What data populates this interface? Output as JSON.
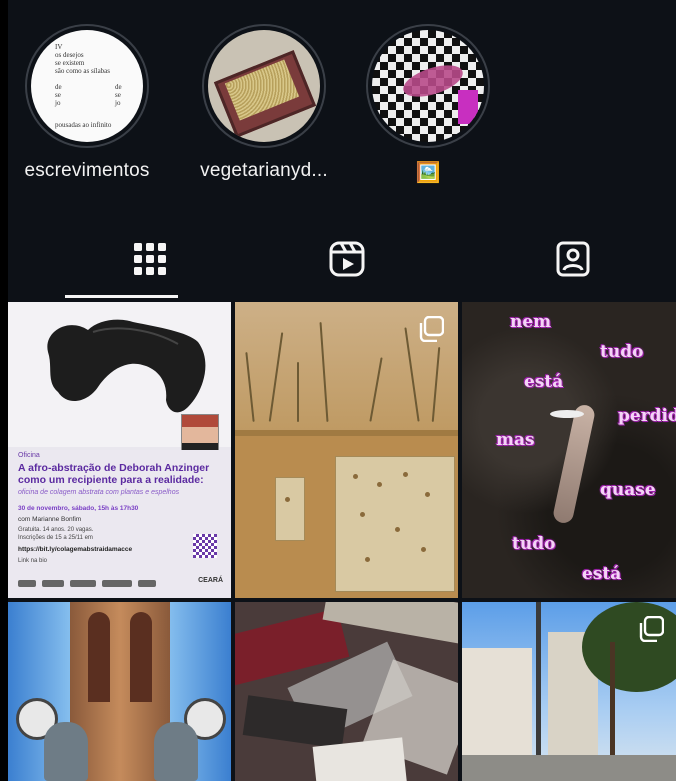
{
  "highlights": [
    {
      "name": "escrevimentos",
      "cover_lines": [
        "IV",
        "os desejos",
        "se existem",
        "são como as sílabas",
        "de",
        "se",
        "jo",
        "de",
        "se",
        "jo",
        "pousadas ao infinito"
      ]
    },
    {
      "name": "vegetarianyd..."
    },
    {
      "name": "🖼️"
    }
  ],
  "tabs": [
    {
      "id": "grid",
      "icon": "grid-icon",
      "selected": true
    },
    {
      "id": "reels",
      "icon": "reels-icon",
      "selected": false
    },
    {
      "id": "tagged",
      "icon": "tagged-icon",
      "selected": false
    }
  ],
  "posts": {
    "p1": {
      "kicker": "Oficina",
      "title": "A afro-abstração de Deborah Anzinger como um recipiente para a realidade:",
      "subtitle": "oficina de colagem abstrata com plantas e espelhos",
      "date": "30 de novembro, sábado, 15h às 17h30",
      "by": "com Marianne Bonfim",
      "info1": "Gratuita. 14 anos. 20 vagas.",
      "info2": "Inscrições de 15 a 25/11 em",
      "link": "https://bit.ly/colagemabstraidamacce",
      "bio": "Link na bio",
      "org": "CEARÁ"
    },
    "p3": {
      "words": [
        "nem",
        "tudo",
        "está",
        "perdido",
        "mas",
        "quase",
        "tudo",
        "está"
      ]
    }
  },
  "colors": {
    "background": "#0d1117",
    "text": "#f5f5f5",
    "ring": "#3a3f47",
    "flyer_purple": "#5b2aa0",
    "poem_pink": "#f4d4f6"
  }
}
